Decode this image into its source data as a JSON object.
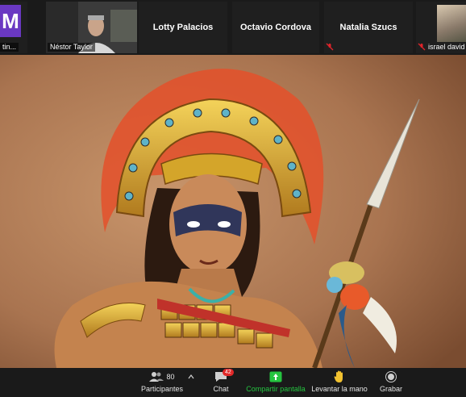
{
  "participants_strip": {
    "tiles": [
      {
        "initial": "M",
        "caption": "tin..."
      },
      {
        "caption": "Néstor Taylor"
      },
      {
        "name": "Lotty Palacios"
      },
      {
        "name": "Octavio Cordova"
      },
      {
        "name": "Natalia Szucs"
      },
      {
        "caption": "israel david"
      }
    ]
  },
  "toolbar": {
    "participants_count": "80",
    "participants_label": "Participantes",
    "chat_badge": "42",
    "chat_label": "Chat",
    "share_label": "Compartir pantalla",
    "raise_hand_label": "Levantar la mano",
    "record_label": "Grabar"
  },
  "colors": {
    "share_green": "#25c540",
    "avatar_purple": "#6a38c2",
    "badge_red": "#e02828",
    "mute_red": "#e0242b"
  },
  "icons": [
    "participants-icon",
    "caret-up-icon",
    "chat-icon",
    "share-screen-icon",
    "raise-hand-icon",
    "record-icon",
    "mic-muted-icon"
  ]
}
